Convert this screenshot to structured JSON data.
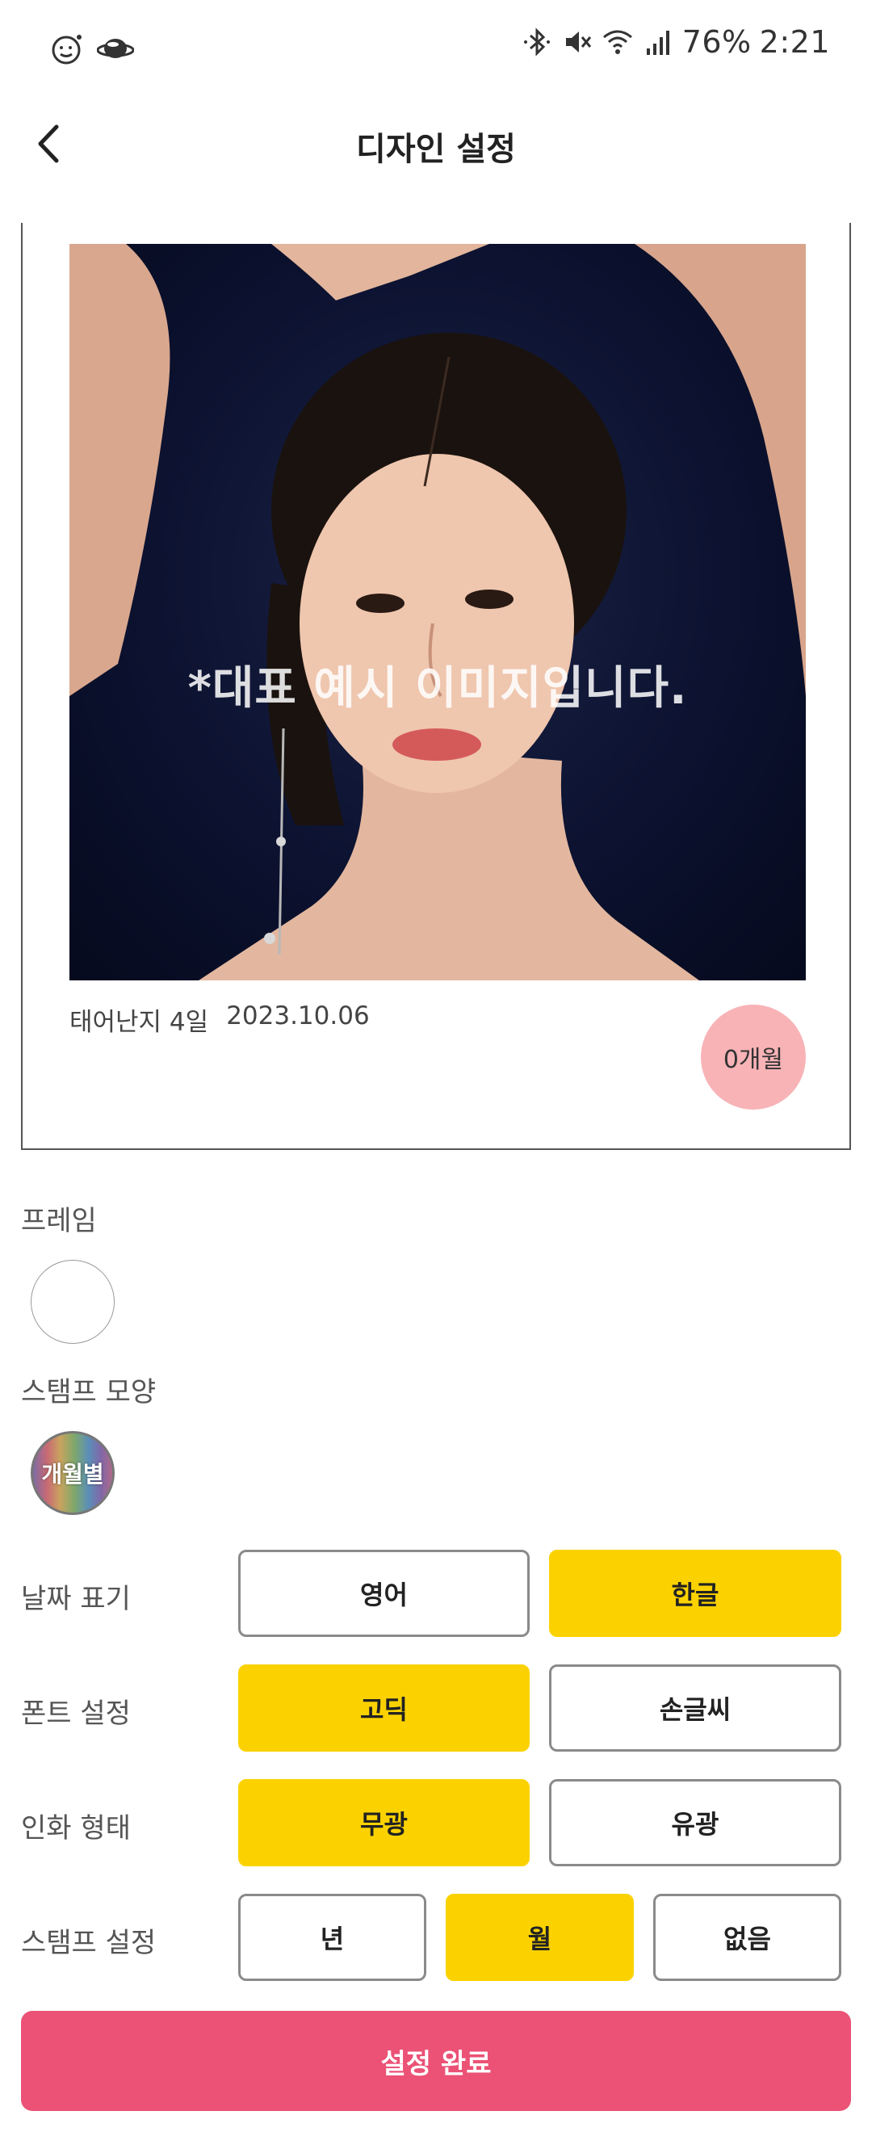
{
  "status_bar": {
    "left_icons": [
      "face-emoji-icon",
      "planet-icon"
    ],
    "right_icons": [
      "bluetooth-icon",
      "mute-icon",
      "wifi-icon",
      "signal-icon"
    ],
    "battery": "76%",
    "time": "2:21"
  },
  "header": {
    "back_icon": "chevron-left-icon",
    "title": "디자인 설정"
  },
  "preview": {
    "overlay_text": "*대표 예시 이미지입니다.",
    "caption_label": "태어난지 4일",
    "caption_date": "2023.10.06",
    "month_badge": "0개월",
    "badge_color": "#f8b3b6"
  },
  "frame": {
    "label": "프레임"
  },
  "stamp_shape": {
    "label": "스탬프 모양",
    "option_label": "개월별"
  },
  "options": {
    "date_display": {
      "label": "날짜 표기",
      "choices": [
        "영어",
        "한글"
      ],
      "selected": "한글"
    },
    "font": {
      "label": "폰트 설정",
      "choices": [
        "고딕",
        "손글씨"
      ],
      "selected": "고딕"
    },
    "print_type": {
      "label": "인화 형태",
      "choices": [
        "무광",
        "유광"
      ],
      "selected": "무광"
    },
    "stamp_setting": {
      "label": "스탬프 설정",
      "choices": [
        "년",
        "월",
        "없음"
      ],
      "selected": "월"
    }
  },
  "submit": {
    "label": "설정 완료",
    "color": "#eb5276"
  },
  "colors": {
    "selected": "#fbd200",
    "unselected_border": "#8a8a8a"
  }
}
